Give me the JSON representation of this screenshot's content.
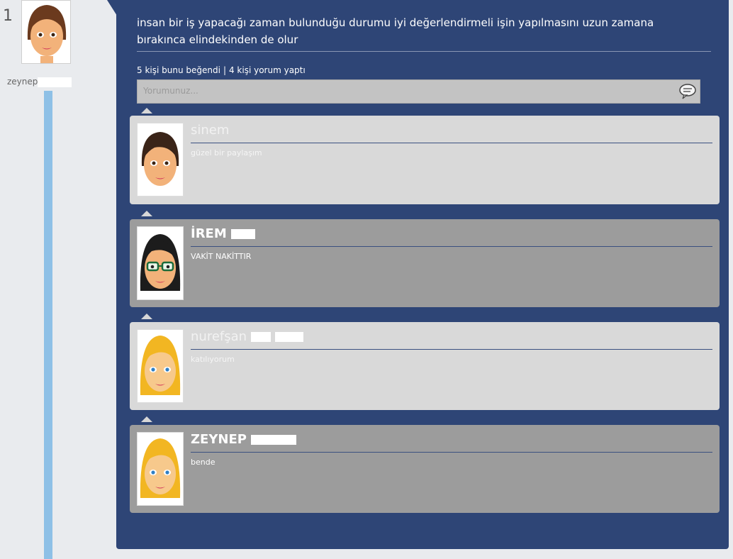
{
  "post": {
    "rank": "1",
    "author": "zeynep",
    "text": "insan bir iş yapacağı zaman bulunduğu durumu iyi değerlendirmeli işin yapılmasını uzun zamana bırakınca elindekinden de olur",
    "likes_text": "5 kişi bunu beğendi",
    "separator": "|",
    "comments_text": "4 kişi yorum yaptı"
  },
  "comment_box": {
    "placeholder": "Yorumunuz..."
  },
  "comments": [
    {
      "name": "sinem",
      "text": "güzel bir paylaşım",
      "avatar": "brunette-girl-icon"
    },
    {
      "name": "İREM",
      "text": "VAKİT NAKİTTIR",
      "avatar": "black-hair-glasses-girl-icon"
    },
    {
      "name": "nurefşan",
      "text": "katılıyorum",
      "avatar": "blonde-girl-icon"
    },
    {
      "name": "ZEYNEP",
      "text": "bende",
      "avatar": "blonde-girl-icon"
    }
  ],
  "colors": {
    "panel": "#2e4576",
    "timeline": "#8ec0e6",
    "comment_light": "#d9d9d9",
    "comment_dark": "#9c9c9c"
  }
}
